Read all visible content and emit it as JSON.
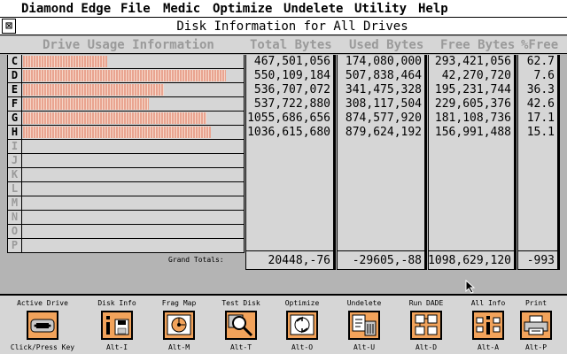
{
  "menu": [
    "Diamond Edge",
    "File",
    "Medic",
    "Optimize",
    "Undelete",
    "Utility",
    "Help"
  ],
  "window": {
    "close_glyph": "⊠",
    "title": "Disk Information for All Drives"
  },
  "headers": {
    "usage": "Drive Usage Information",
    "total": "Total Bytes",
    "used": "Used Bytes",
    "free": "Free Bytes",
    "pct": "%Free"
  },
  "drives": [
    {
      "letter": "C",
      "usage_fraction": 0.38,
      "total": "467,501,056",
      "used": "174,080,000",
      "free": "293,421,056",
      "pct_free": "62.7"
    },
    {
      "letter": "D",
      "usage_fraction": 0.92,
      "total": "550,109,184",
      "used": "507,838,464",
      "free": "42,270,720",
      "pct_free": "7.6"
    },
    {
      "letter": "E",
      "usage_fraction": 0.64,
      "total": "536,707,072",
      "used": "341,475,328",
      "free": "195,231,744",
      "pct_free": "36.3"
    },
    {
      "letter": "F",
      "usage_fraction": 0.57,
      "total": "537,722,880",
      "used": "308,117,504",
      "free": "229,605,376",
      "pct_free": "42.6"
    },
    {
      "letter": "G",
      "usage_fraction": 0.83,
      "total": "1055,686,656",
      "used": "874,577,920",
      "free": "181,108,736",
      "pct_free": "17.1"
    },
    {
      "letter": "H",
      "usage_fraction": 0.85,
      "total": "1036,615,680",
      "used": "879,624,192",
      "free": "156,991,488",
      "pct_free": "15.1"
    },
    {
      "letter": "I"
    },
    {
      "letter": "J"
    },
    {
      "letter": "K"
    },
    {
      "letter": "L"
    },
    {
      "letter": "M"
    },
    {
      "letter": "N"
    },
    {
      "letter": "O"
    },
    {
      "letter": "P"
    }
  ],
  "totals": {
    "label": "Grand Totals:",
    "total": "20448,-76",
    "used": "-29605,-88",
    "free": "1098,629,120",
    "pct": "-993"
  },
  "toolbar": [
    {
      "label": "Active Drive",
      "key": "Click/Press Key",
      "icon": "drive-icon"
    },
    {
      "label": "Disk Info",
      "key": "Alt-I",
      "icon": "disk-info-icon"
    },
    {
      "label": "Frag Map",
      "key": "Alt-M",
      "icon": "frag-map-icon"
    },
    {
      "label": "Test Disk",
      "key": "Alt-T",
      "icon": "magnifier-icon"
    },
    {
      "label": "Optimize",
      "key": "Alt-O",
      "icon": "optimize-icon"
    },
    {
      "label": "Undelete",
      "key": "Alt-U",
      "icon": "trash-icon"
    },
    {
      "label": "Run DADE",
      "key": "Alt-D",
      "icon": "dade-icon"
    },
    {
      "label": "All Info",
      "key": "Alt-A",
      "icon": "all-info-icon"
    },
    {
      "label": "Print",
      "key": "Alt-P",
      "icon": "printer-icon"
    }
  ],
  "colors": {
    "bar": "#e9a490",
    "icon_bg": "#f2a35b",
    "panel": "#d6d6d6",
    "desktop": "#b4b4b4"
  }
}
